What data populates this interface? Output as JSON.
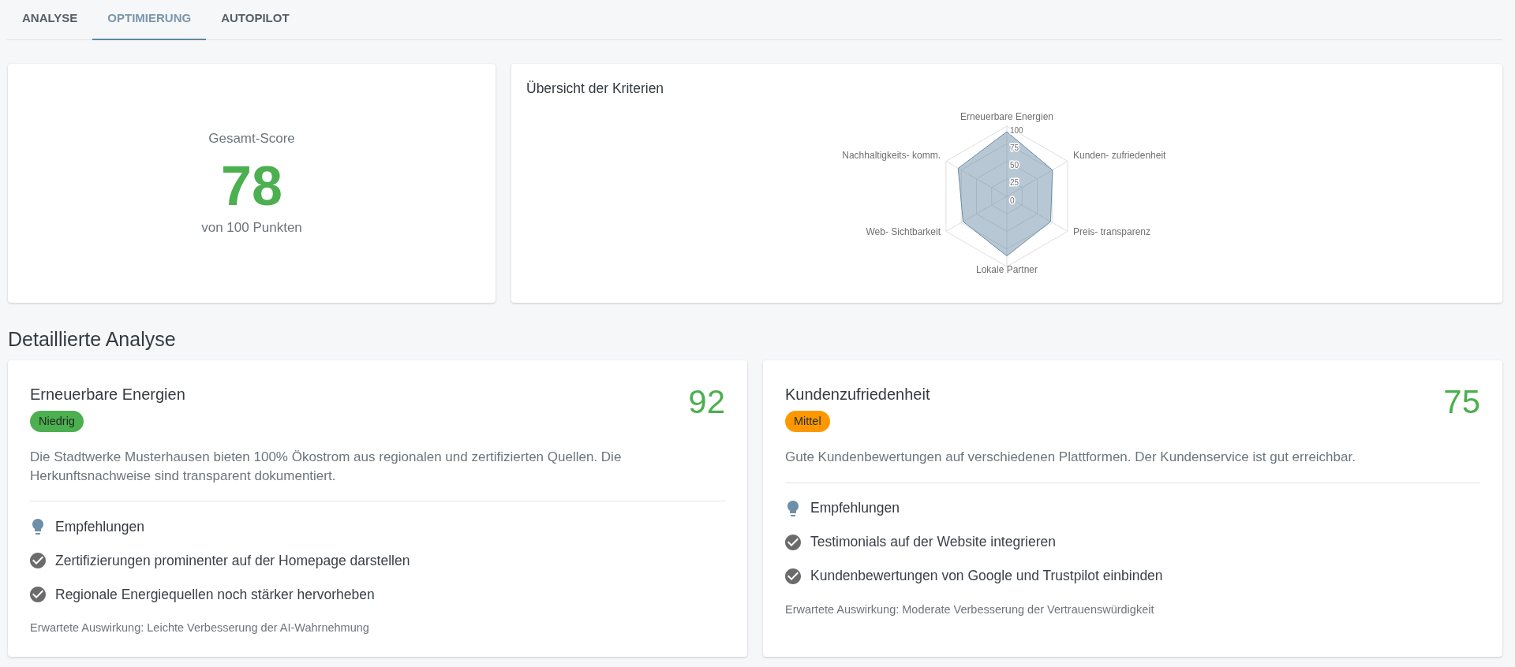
{
  "tabs": [
    {
      "label": "ANALYSE",
      "selected": false
    },
    {
      "label": "OPTIMIERUNG",
      "selected": true
    },
    {
      "label": "AUTOPILOT",
      "selected": false
    }
  ],
  "overall_score": {
    "label": "Gesamt-Score",
    "value": "78",
    "caption": "von 100 Punkten"
  },
  "criteria_overview": {
    "chart_data": {
      "type": "radar",
      "title": "Übersicht der Kriterien",
      "categories": [
        "Erneuerbare Energien",
        "Kunden- zufriedenheit",
        "Preis- transparenz",
        "Lokale Partner",
        "Web- Sichtbarkeit",
        "Nachhaltigkeits- komm."
      ],
      "values": [
        92,
        75,
        72,
        85,
        72,
        80
      ],
      "ylim": [
        0,
        100
      ],
      "yticks": [
        0,
        25,
        50,
        75,
        100
      ]
    }
  },
  "section_title": "Detaillierte Analyse",
  "details": [
    {
      "title": "Erneuerbare Energien",
      "score": "92",
      "badge": {
        "text": "Niedrig",
        "color": "#4caf50"
      },
      "description": "Die Stadtwerke Musterhausen bieten 100% Ökostrom aus regionalen und zertifizierten Quellen. Die Herkunftsnachweise sind transparent dokumentiert.",
      "recommendations": {
        "title": "Empfehlungen",
        "items": [
          "Zertifizierungen prominenter auf der Homepage darstellen",
          "Regionale Energiequellen noch stärker hervorheben"
        ]
      },
      "impact": "Erwartete Auswirkung: Leichte Verbesserung der AI-Wahrnehmung"
    },
    {
      "title": "Kundenzufriedenheit",
      "score": "75",
      "badge": {
        "text": "Mittel",
        "color": "#ff9800"
      },
      "description": "Gute Kundenbewertungen auf verschiedenen Plattformen. Der Kundenservice ist gut erreichbar.",
      "recommendations": {
        "title": "Empfehlungen",
        "items": [
          "Testimonials auf der Website integrieren",
          "Kundenbewertungen von Google und Trustpilot einbinden"
        ]
      },
      "impact": "Erwartete Auswirkung: Moderate Verbesserung der Vertrauenswürdigkeit"
    }
  ]
}
